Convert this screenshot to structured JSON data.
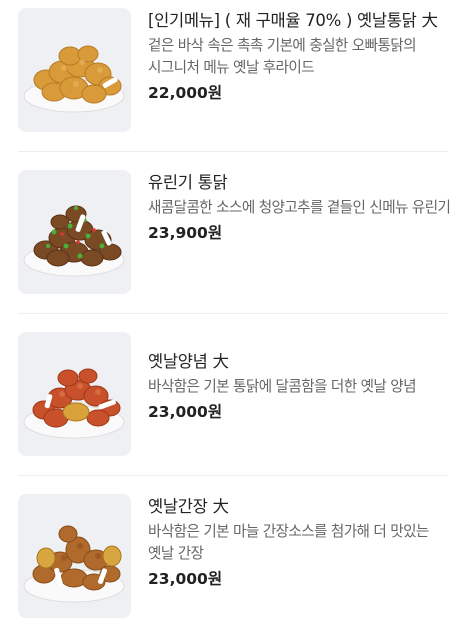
{
  "menu": {
    "items": [
      {
        "name": "[인기메뉴] ( 재 구매율 70% ) 옛날통닭 大",
        "description": "겉은 바삭 속은 촉촉 기본에 충실한 오빠통닭의 시그니처 메뉴 옛날 후라이드",
        "price": "22,000원",
        "image_icon": "fried-chicken-icon"
      },
      {
        "name": "유린기 통닭",
        "description": "새콤달콤한 소스에 청양고추를 곁들인 신메뉴 유린기",
        "price": "23,900원",
        "image_icon": "yuringi-chicken-icon"
      },
      {
        "name": "옛날양념 大",
        "description": "바삭함은 기본 통닭에 달콤함을 더한 옛날 양념",
        "price": "23,000원",
        "image_icon": "seasoned-chicken-icon"
      },
      {
        "name": "옛날간장 大",
        "description": "바삭함은 기본 마늘 간장소스를 첨가해 더 맛있는 옛날 간장",
        "price": "23,000원",
        "image_icon": "soy-chicken-icon"
      }
    ]
  },
  "colors": {
    "background": "#ffffff",
    "thumbnail_bg": "#eef0f3",
    "name_text": "#222222",
    "description_text": "#666666",
    "divider": "#eeeeee"
  }
}
